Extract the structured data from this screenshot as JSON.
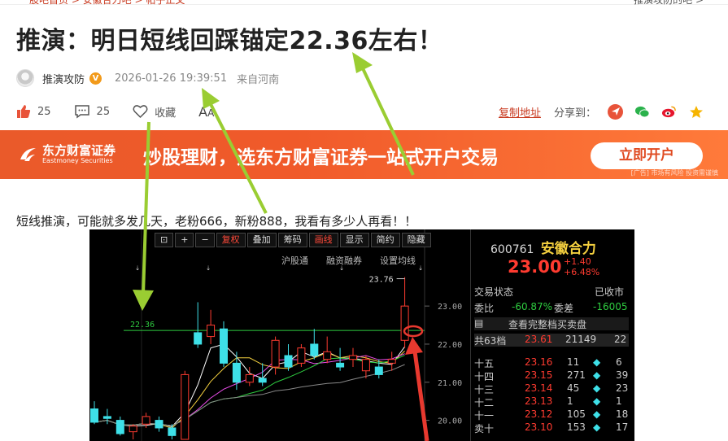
{
  "breadcrumb": {
    "text": "股吧首页 > 安徽合力吧 > 帖子正文"
  },
  "top_right": {
    "text": "推演攻防的吧 >"
  },
  "post": {
    "title": "推演：明日短线回踩锚定22.36左右！",
    "author": "推演攻防",
    "verified_badge": "V",
    "time": "2026-01-26 19:39:51",
    "location": "来自河南",
    "body": "短线推演，可能就多发几天，老粉666，新粉888，我看有多少人再看！！"
  },
  "actions": {
    "like_count": "25",
    "comment_count": "25",
    "favorite_label": "收藏",
    "font_size_label_big": "A",
    "font_size_label_small": "A"
  },
  "share": {
    "copy_link": "复制地址",
    "share_to": "分享到："
  },
  "banner": {
    "logo_cn": "东方财富证券",
    "logo_en": "Eastmoney Securities",
    "slogan": "炒股理财，选东方财富证券一站式开户交易",
    "cta": "立即开户",
    "ad_note": "[广告] 市场有风险 投资需谨慎"
  },
  "chart_toolbar": [
    "复权",
    "叠加",
    "筹码",
    "画线",
    "显示",
    "简约",
    "隐藏"
  ],
  "chart_subtoolbar": [
    "沪股通",
    "融资融券",
    "设置均线"
  ],
  "chart_labels": {
    "peak": "23.76",
    "anchor": "22.36",
    "yticks": [
      "23.00",
      "22.00",
      "21.00",
      "20.00"
    ]
  },
  "quote": {
    "code": "600761",
    "name": "安徽合力",
    "price": "23.00",
    "change": "+1.40",
    "change_pct": "+6.48%",
    "status_label": "交易状态",
    "status_value": "已收市",
    "weibi_label": "委比",
    "weibi_value": "-60.87%",
    "weicha_label": "委差",
    "weicha_value": "-16005",
    "full_book": "查看完整档买卖盘",
    "total_levels": "共63档",
    "top_price": "23.61",
    "top_vol": "21149",
    "top_count": "22",
    "asks": [
      {
        "level": "十五",
        "price": "23.16",
        "vol": "11",
        "count": "6"
      },
      {
        "level": "十四",
        "price": "23.15",
        "vol": "271",
        "count": "39"
      },
      {
        "level": "十三",
        "price": "23.14",
        "vol": "45",
        "count": "23"
      },
      {
        "level": "十二",
        "price": "23.13",
        "vol": "1",
        "count": "1"
      },
      {
        "level": "十一",
        "price": "23.12",
        "vol": "105",
        "count": "18"
      },
      {
        "level": "卖十",
        "price": "23.10",
        "vol": "153",
        "count": "17"
      }
    ]
  },
  "chart_data": {
    "type": "candlestick",
    "candles": [
      {
        "o": 20.3,
        "h": 20.5,
        "l": 19.9,
        "c": 19.95,
        "up": false
      },
      {
        "o": 20.1,
        "h": 20.3,
        "l": 19.9,
        "c": 20.05,
        "up": false
      },
      {
        "o": 20.0,
        "h": 20.1,
        "l": 19.6,
        "c": 19.65,
        "up": false
      },
      {
        "o": 19.7,
        "h": 19.9,
        "l": 19.5,
        "c": 19.85,
        "up": true
      },
      {
        "o": 19.9,
        "h": 20.2,
        "l": 19.8,
        "c": 20.1,
        "up": true
      },
      {
        "o": 20.0,
        "h": 20.1,
        "l": 19.7,
        "c": 19.8,
        "up": false
      },
      {
        "o": 19.8,
        "h": 19.9,
        "l": 19.5,
        "c": 19.6,
        "up": false
      },
      {
        "o": 19.5,
        "h": 21.3,
        "l": 19.5,
        "c": 21.2,
        "up": true
      },
      {
        "o": 22.3,
        "h": 23.1,
        "l": 21.9,
        "c": 22.0,
        "up": false
      },
      {
        "o": 22.2,
        "h": 22.9,
        "l": 22.0,
        "c": 22.5,
        "up": true
      },
      {
        "o": 22.4,
        "h": 22.6,
        "l": 21.4,
        "c": 21.5,
        "up": false
      },
      {
        "o": 21.5,
        "h": 21.8,
        "l": 20.8,
        "c": 21.0,
        "up": false
      },
      {
        "o": 21.0,
        "h": 21.4,
        "l": 20.9,
        "c": 21.2,
        "up": true
      },
      {
        "o": 21.0,
        "h": 21.5,
        "l": 20.9,
        "c": 21.1,
        "up": false
      },
      {
        "o": 21.4,
        "h": 22.2,
        "l": 21.2,
        "c": 22.1,
        "up": true
      },
      {
        "o": 21.7,
        "h": 22.0,
        "l": 21.3,
        "c": 21.4,
        "up": false
      },
      {
        "o": 21.5,
        "h": 22.0,
        "l": 21.4,
        "c": 21.9,
        "up": true
      },
      {
        "o": 22.0,
        "h": 22.4,
        "l": 21.6,
        "c": 21.7,
        "up": false
      },
      {
        "o": 21.6,
        "h": 22.2,
        "l": 21.5,
        "c": 21.8,
        "up": true
      },
      {
        "o": 21.5,
        "h": 21.9,
        "l": 21.3,
        "c": 21.4,
        "up": false
      },
      {
        "o": 21.6,
        "h": 21.9,
        "l": 21.4,
        "c": 21.7,
        "up": true
      },
      {
        "o": 21.3,
        "h": 21.7,
        "l": 21.1,
        "c": 21.6,
        "up": true
      },
      {
        "o": 21.4,
        "h": 21.6,
        "l": 21.1,
        "c": 21.2,
        "up": false
      },
      {
        "o": 21.5,
        "h": 21.8,
        "l": 21.3,
        "c": 21.6,
        "up": true
      },
      {
        "o": 22.1,
        "h": 23.76,
        "l": 21.9,
        "c": 23.0,
        "up": true
      }
    ],
    "anchor_line": 22.36,
    "ylim": [
      19.5,
      23.9
    ]
  },
  "colors": {
    "accent": "#c8391f",
    "banner": "#f05a2a",
    "arrow_green": "#9acd32",
    "arrow_red": "#e8392f"
  }
}
